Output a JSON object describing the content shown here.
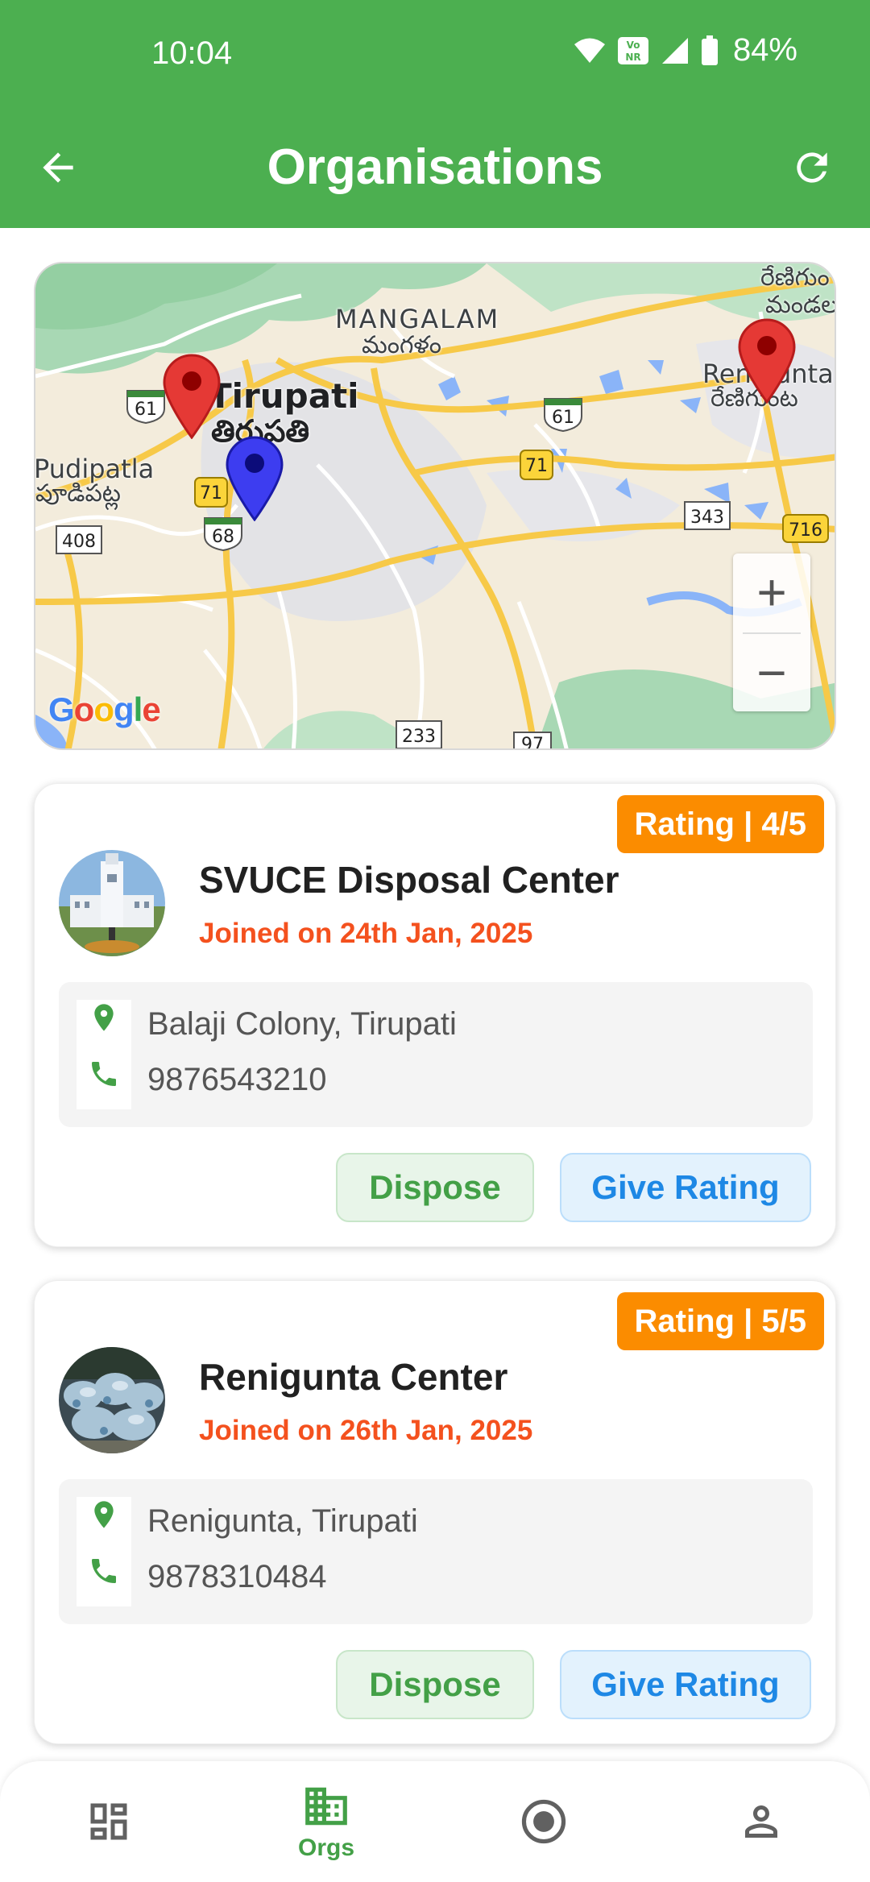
{
  "status_bar": {
    "time": "10:04",
    "battery_percent": "84%",
    "volte_badge": "Vo NR",
    "icons": [
      "wifi-icon",
      "volte-icon",
      "signal-icon",
      "battery-icon"
    ]
  },
  "app_bar": {
    "title": "Organisations",
    "back_icon": "arrow-back-icon",
    "refresh_icon": "refresh-icon",
    "color": "#4caf50"
  },
  "map": {
    "labels": {
      "tirupati": "Tirupati",
      "tirupati_te": "తిరుపతి",
      "mangalam": "MANGALAM",
      "mangalam_te": "మంగళం",
      "renigunta": "Renigunta",
      "renigunta_te": "రేణిగుంట",
      "pudipatla": "Pudipatla",
      "pudipatla_te": "పూడిపట్ల",
      "corner_te1": "రేణిగుం",
      "corner_te2": "మండల"
    },
    "road_shields": [
      "61",
      "61",
      "71",
      "71",
      "68",
      "408",
      "233",
      "343",
      "97",
      "716"
    ],
    "zoom_in": "+",
    "zoom_out": "−",
    "attribution": "Google",
    "markers": [
      "red-marker",
      "red-marker",
      "blue-marker"
    ]
  },
  "organisations": [
    {
      "rating": "Rating | 4/5",
      "name": "SVUCE Disposal Center",
      "joined": "Joined on 24th Jan, 2025",
      "address": "Balaji Colony, Tirupati",
      "phone": "9876543210",
      "dispose_label": "Dispose",
      "rate_label": "Give Rating"
    },
    {
      "rating": "Rating | 5/5",
      "name": "Renigunta Center",
      "joined": "Joined on 26th Jan, 2025",
      "address": "Renigunta, Tirupati",
      "phone": "9878310484",
      "dispose_label": "Dispose",
      "rate_label": "Give Rating"
    }
  ],
  "bottom_nav": {
    "items": [
      {
        "icon": "dashboard-icon",
        "label": ""
      },
      {
        "icon": "business-icon",
        "label": "Orgs"
      },
      {
        "icon": "radio-target-icon",
        "label": ""
      },
      {
        "icon": "person-icon",
        "label": ""
      }
    ],
    "active_color": "#43a047",
    "inactive_color": "#616161"
  }
}
